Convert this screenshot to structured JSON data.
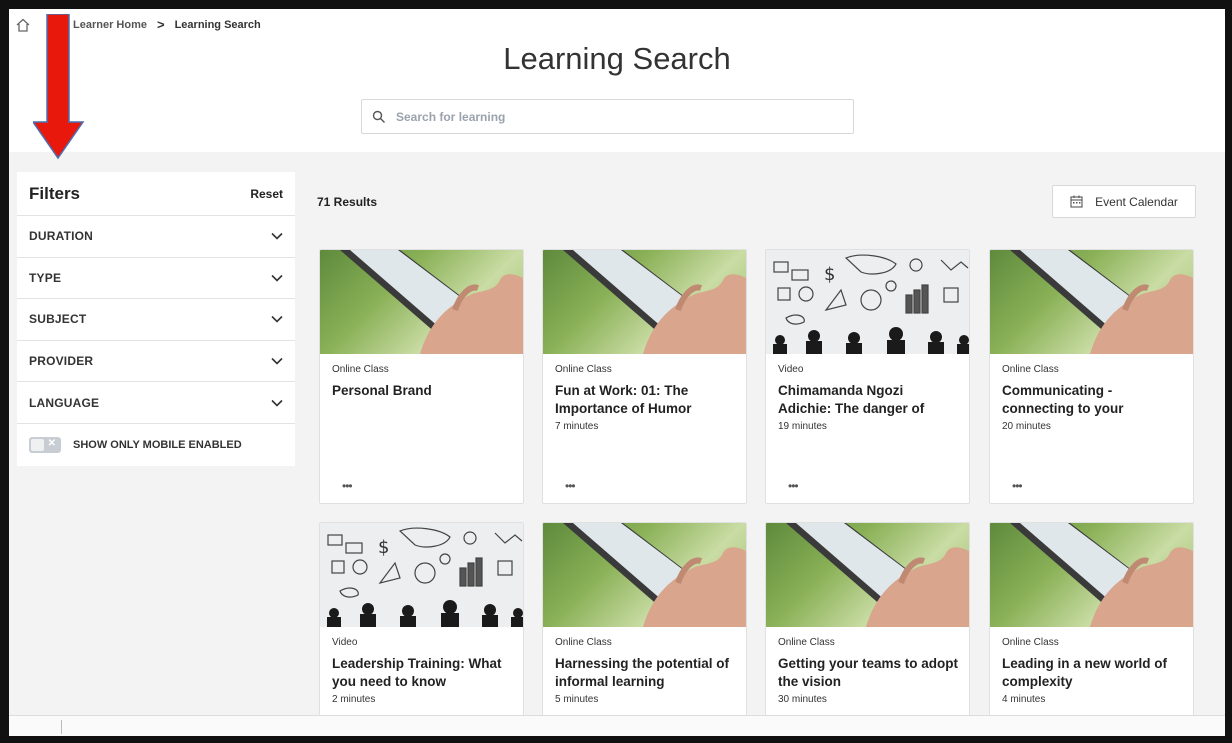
{
  "breadcrumb": {
    "home_label": "Learner Home",
    "separator": ">",
    "current": "Learning Search"
  },
  "header": {
    "title": "Learning Search"
  },
  "search": {
    "placeholder": "Search for learning",
    "value": ""
  },
  "filters": {
    "title": "Filters",
    "reset_label": "Reset",
    "items": [
      {
        "label": "DURATION"
      },
      {
        "label": "TYPE"
      },
      {
        "label": "SUBJECT"
      },
      {
        "label": "PROVIDER"
      },
      {
        "label": "LANGUAGE"
      }
    ],
    "mobile_toggle": {
      "label": "SHOW ONLY MOBILE ENABLED",
      "state": "off"
    }
  },
  "results": {
    "count_label": "71 Results",
    "calendar_label": "Event Calendar"
  },
  "cards": [
    {
      "type": "Online Class",
      "title": "Personal Brand",
      "duration": "",
      "thumbnail": "tablet-hand"
    },
    {
      "type": "Online Class",
      "title": "Fun at Work: 01: The Importance of Humor",
      "duration": "7 minutes",
      "thumbnail": "tablet-hand"
    },
    {
      "type": "Video",
      "title": "Chimamanda Ngozi Adichie: The danger of",
      "duration": "19 minutes",
      "thumbnail": "doodle-icons"
    },
    {
      "type": "Online Class",
      "title": "Communicating - connecting to your",
      "duration": "20 minutes",
      "thumbnail": "tablet-hand"
    },
    {
      "type": "Video",
      "title": "Leadership Training: What you need to know",
      "duration": "2 minutes",
      "thumbnail": "doodle-icons"
    },
    {
      "type": "Online Class",
      "title": "Harnessing the potential of informal learning",
      "duration": "5 minutes",
      "thumbnail": "tablet-hand"
    },
    {
      "type": "Online Class",
      "title": "Getting your teams to adopt the vision",
      "duration": "30 minutes",
      "thumbnail": "tablet-hand"
    },
    {
      "type": "Online Class",
      "title": "Leading in a new world of complexity",
      "duration": "4 minutes",
      "thumbnail": "tablet-hand"
    }
  ],
  "card_more_label": "•••",
  "colors": {
    "frame": "#111111",
    "page_bg": "#f3f3f3",
    "annotation_arrow": "#e8190c"
  }
}
